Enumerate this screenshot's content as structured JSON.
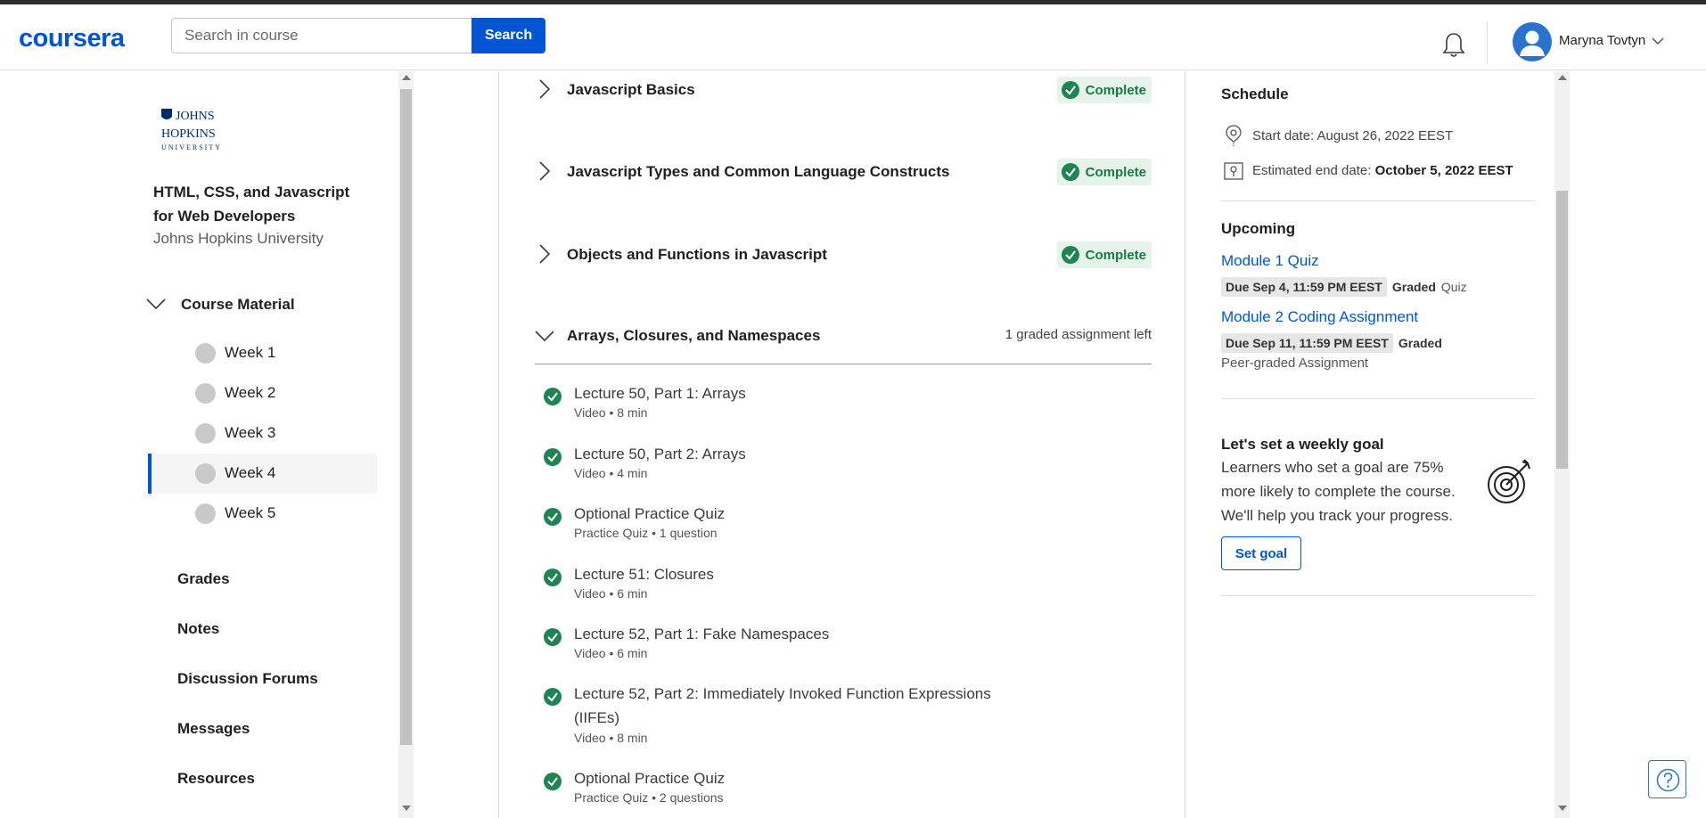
{
  "header": {
    "logo": "coursera",
    "search_placeholder": "Search in course",
    "search_button": "Search",
    "user_name": "Maryna Tovtyn"
  },
  "sidebar": {
    "course_title": "HTML, CSS, and Javascript for Web Developers",
    "university": "Johns Hopkins University",
    "logo_lines": [
      "JOHNS",
      "HOPKINS",
      "UNIVERSITY"
    ],
    "course_material_label": "Course Material",
    "weeks": [
      "Week 1",
      "Week 2",
      "Week 3",
      "Week 4",
      "Week 5"
    ],
    "active_week": "Week 4",
    "links": [
      "Grades",
      "Notes",
      "Discussion Forums",
      "Messages",
      "Resources"
    ]
  },
  "main": {
    "modules": [
      {
        "title": "Javascript Basics",
        "status": "Complete"
      },
      {
        "title": "Javascript Types and Common Language Constructs",
        "status": "Complete"
      },
      {
        "title": "Objects and Functions in Javascript",
        "status": "Complete"
      },
      {
        "title": "Arrays, Closures, and Namespaces",
        "status": "1 graded assignment left"
      }
    ],
    "items": [
      {
        "title": "Lecture 50, Part 1: Arrays",
        "meta": "Video • 8 min"
      },
      {
        "title": "Lecture 50, Part 2: Arrays",
        "meta": "Video • 4 min"
      },
      {
        "title": "Optional Practice Quiz",
        "meta": "Practice Quiz • 1 question"
      },
      {
        "title": "Lecture 51: Closures",
        "meta": "Video • 6 min"
      },
      {
        "title": "Lecture 52, Part 1: Fake Namespaces",
        "meta": "Video • 6 min"
      },
      {
        "title": "Lecture 52, Part 2: Immediately Invoked Function Expressions (IIFEs)",
        "meta": "Video • 8 min"
      },
      {
        "title": "Optional Practice Quiz",
        "meta": "Practice Quiz • 2 questions"
      }
    ]
  },
  "right": {
    "schedule_title": "Schedule",
    "start_label": "Start date: August 26, 2022 EEST",
    "end_label": "Estimated end date: ",
    "end_value": "October 5, 2022 EEST",
    "upcoming_title": "Upcoming",
    "upcoming": [
      {
        "title": "Module 1 Quiz",
        "due": "Due Sep 4, 11:59 PM EEST",
        "graded": "Graded",
        "type": "Quiz"
      },
      {
        "title": "Module 2 Coding Assignment",
        "due": "Due Sep 11, 11:59 PM EEST",
        "graded": "Graded",
        "type": "Peer-graded Assignment"
      }
    ],
    "goal_title": "Let's set a weekly goal",
    "goal_text": "Learners who set a goal are 75% more likely to complete the course. We'll help you track your progress.",
    "goal_button": "Set goal"
  },
  "colors": {
    "brand": "#0056d2",
    "complete_green": "#167b43",
    "complete_bg": "#e6f3ea"
  }
}
